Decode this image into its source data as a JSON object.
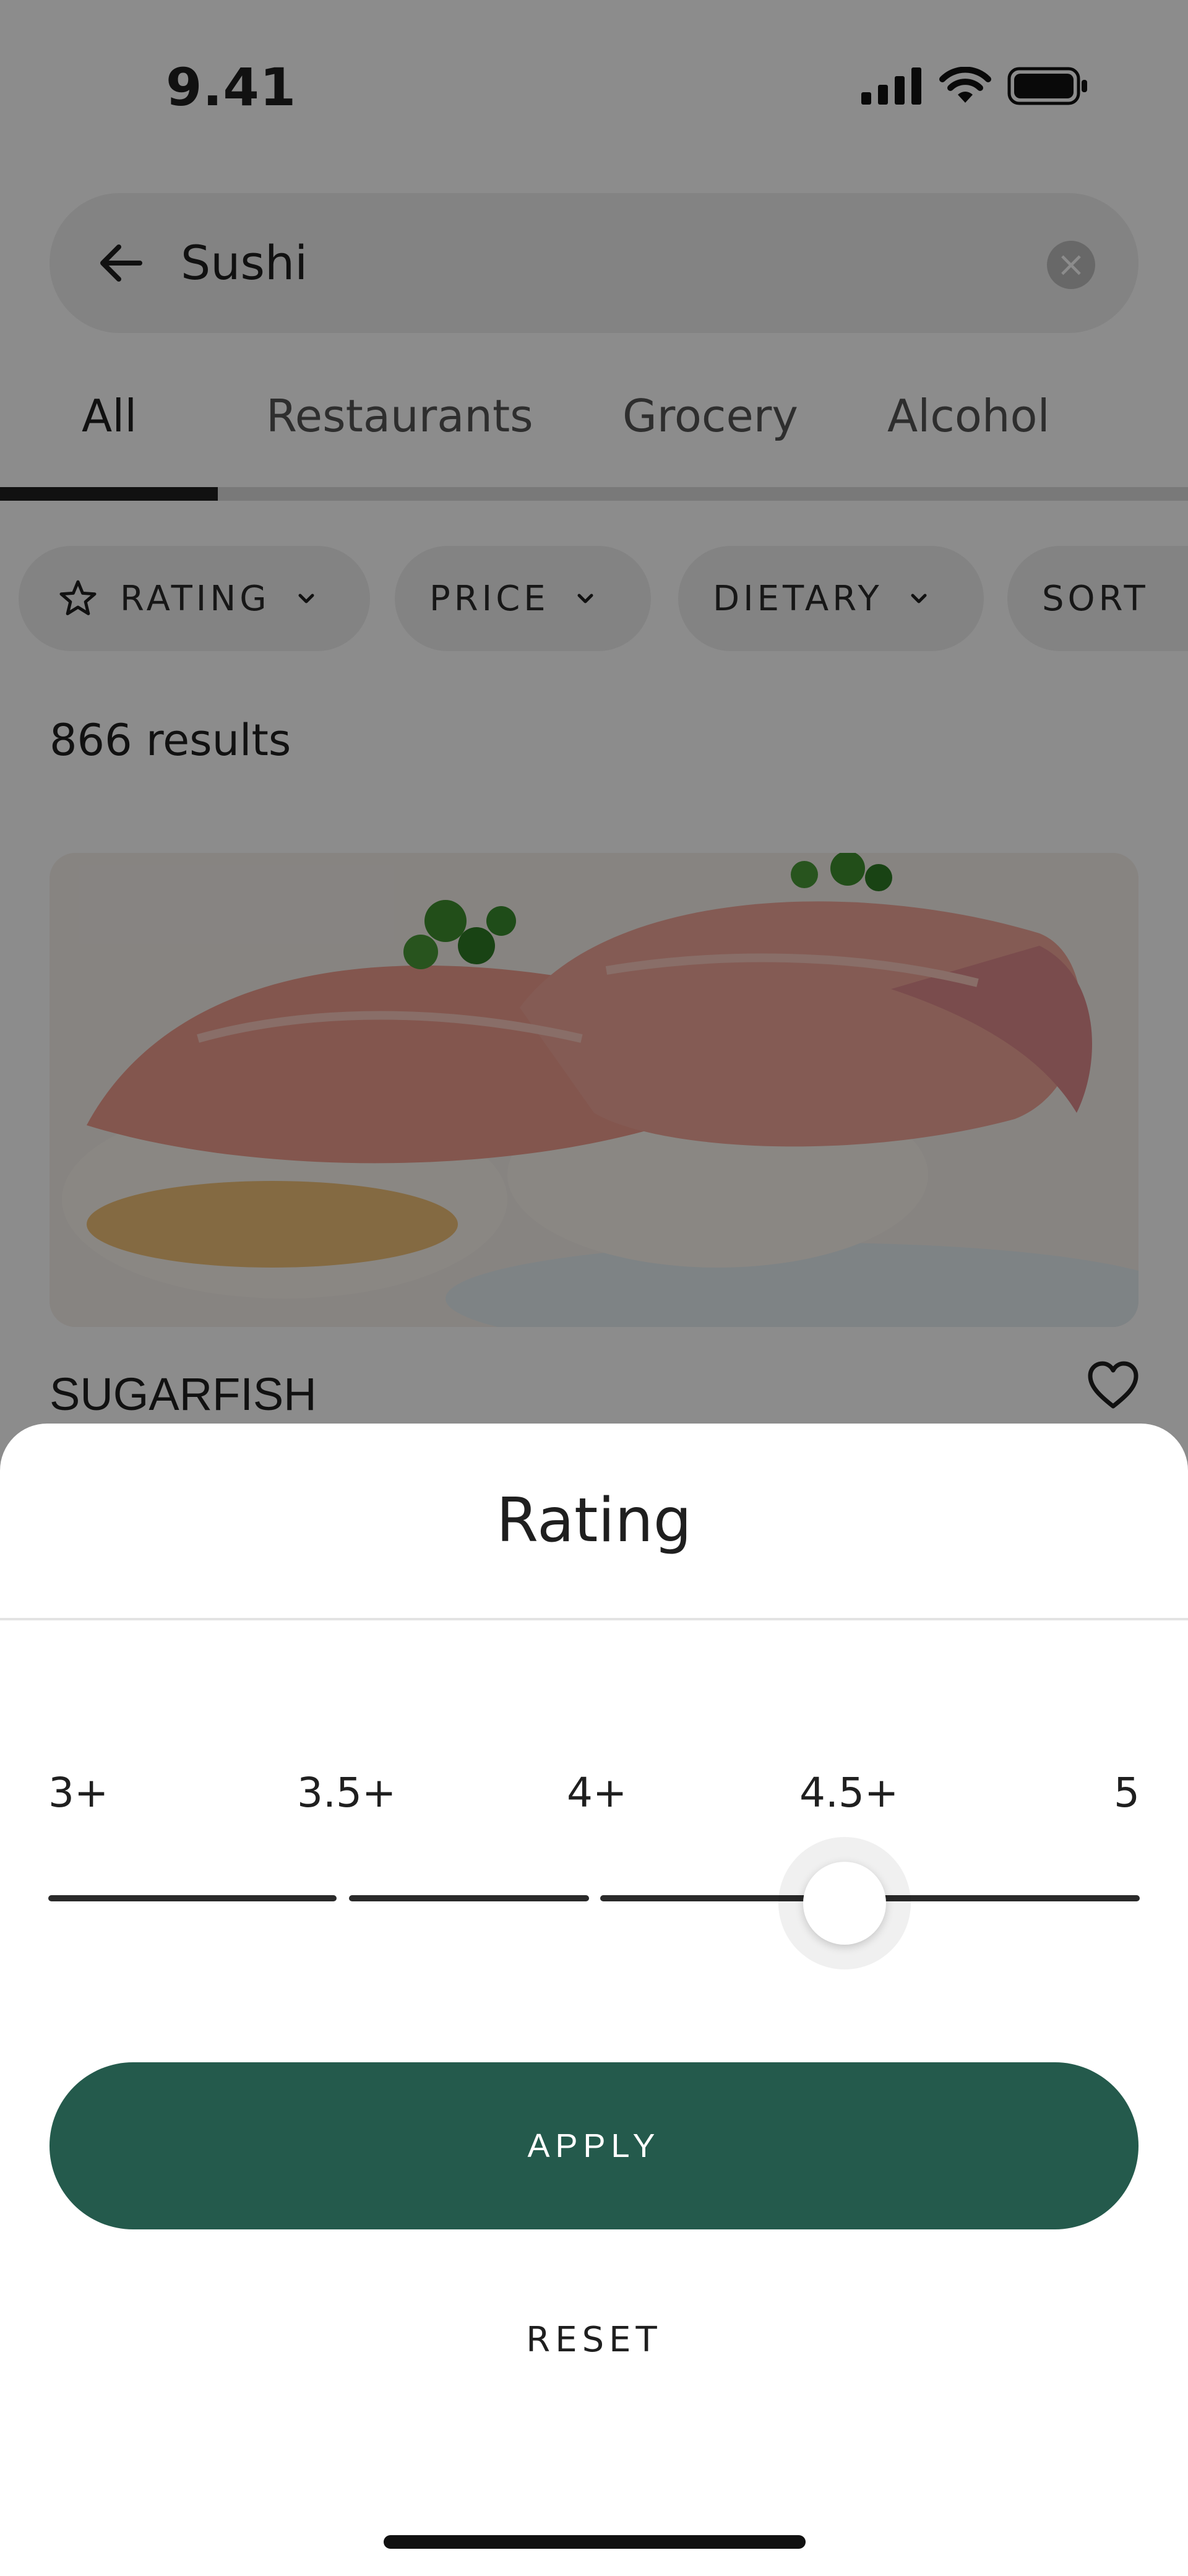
{
  "status_bar": {
    "time": "9.41",
    "icons": [
      "signal-icon",
      "wifi-icon",
      "battery-icon"
    ]
  },
  "search": {
    "value": "Sushi",
    "back_icon": "arrow-left-icon",
    "clear_icon": "clear-icon",
    "clear_glyph": "×"
  },
  "tabs": [
    {
      "label": "All",
      "active": true
    },
    {
      "label": "Restaurants",
      "active": false
    },
    {
      "label": "Grocery",
      "active": false
    },
    {
      "label": "Alcohol",
      "active": false
    }
  ],
  "filters": [
    {
      "label": "RATING",
      "icon": "star-icon"
    },
    {
      "label": "PRICE"
    },
    {
      "label": "DIETARY"
    },
    {
      "label": "SORT"
    }
  ],
  "results": {
    "count_text": "866 results"
  },
  "listing": {
    "name": "SUGARFISH",
    "image": "sushi-photo",
    "favorite_icon": "heart-icon"
  },
  "sheet": {
    "title": "Rating",
    "slider": {
      "labels": [
        "3+",
        "3.5+",
        "4+",
        "4.5+",
        "5"
      ],
      "selected": "4.5+"
    },
    "apply_label": "APPLY",
    "reset_label": "RESET"
  },
  "colors": {
    "apply_button": "#245a4c",
    "overlay": "rgba(0,0,0,0.45)",
    "tab_indicator": "#1f1f1f"
  }
}
